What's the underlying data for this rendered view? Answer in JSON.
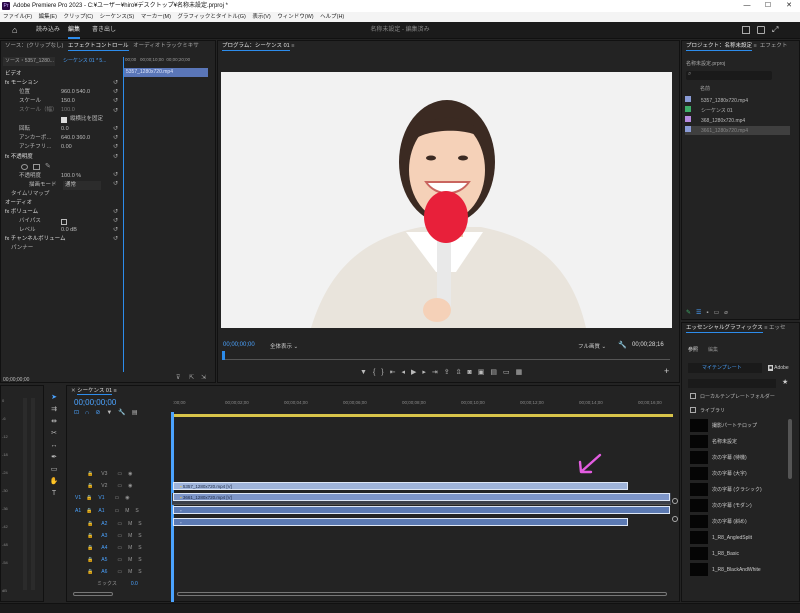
{
  "window": {
    "title": "Adobe Premiere Pro 2023 - C:¥ユーザー¥hiro¥デスクトップ¥名称未設定.prproj *",
    "app_badge": "Pr",
    "minimize": "—",
    "maximize": "☐",
    "close": "✕"
  },
  "menu": [
    "ファイル(F)",
    "編集(E)",
    "クリップ(C)",
    "シーケンス(S)",
    "マーカー(M)",
    "グラフィックとタイトル(G)",
    "表示(V)",
    "ウィンドウ(W)",
    "ヘルプ(H)"
  ],
  "workspace": {
    "tabs": [
      "読み込み",
      "編集",
      "書き出し"
    ],
    "active": "編集",
    "center_title": "名称未設定 - 編集済み"
  },
  "effect_controls": {
    "tabs": [
      "ソース：(クリップなし)",
      "エフェクトコントロール",
      "オーディオトラックミキサ"
    ],
    "source_label": "ソース・5357_1280...",
    "sequence_label": "シーケンス 01 * 5...",
    "clip_name": "5357_1280x720.mp4",
    "timecodes": [
      "00;00",
      "00;00;10;00",
      "00;00;20;00"
    ],
    "video_section": "ビデオ",
    "audio_section": "オーディオ",
    "rows": [
      {
        "label": "fx  モーション",
        "value": ""
      },
      {
        "label": "位置",
        "value": "960.0   540.0"
      },
      {
        "label": "スケール",
        "value": "150.0"
      },
      {
        "label": "スケール（幅）",
        "value": "100.0"
      },
      {
        "label": "縦横比を固定",
        "value": ""
      },
      {
        "label": "回転",
        "value": "0.0"
      },
      {
        "label": "アンカーポ…",
        "value": "640.0   360.0"
      },
      {
        "label": "アンチフリ…",
        "value": "0.00"
      },
      {
        "label": "fx  不透明度",
        "value": ""
      },
      {
        "label": "不透明度",
        "value": "100.0 %"
      },
      {
        "label": "描画モード",
        "value": "通常"
      },
      {
        "label": "タイムリマップ",
        "value": ""
      },
      {
        "label": "fx  ボリューム",
        "value": ""
      },
      {
        "label": "バイパス",
        "value": ""
      },
      {
        "label": "レベル",
        "value": "0.0 dB"
      },
      {
        "label": "fx  チャンネルボリューム",
        "value": ""
      },
      {
        "label": "パンナー",
        "value": ""
      }
    ],
    "footer_timecode": "00;00;00;00"
  },
  "program_monitor": {
    "title": "プログラム：シーケンス 01",
    "timecode": "00;00;00;00",
    "fit": "全体表示",
    "quality": "フル画質",
    "duration": "00;00;28;16"
  },
  "project": {
    "tabs": [
      "プロジェクト：名称未設定",
      "エフェクト"
    ],
    "file_name": "名称未設定.prproj",
    "column": "名前",
    "items": [
      {
        "name": "5357_1280x720.mp4",
        "color": "#8a9bd6"
      },
      {
        "name": "シーケンス 01",
        "color": "#3fae6a"
      },
      {
        "name": "368_1280x720.mp4",
        "color": "#b58ae0"
      },
      {
        "name": "3661_1280x720.mp4",
        "color": "#8a9bd6"
      }
    ]
  },
  "essential_graphics": {
    "title": "エッセンシャルグラフィックス",
    "tab2": "エッセ",
    "subtabs": [
      "参照",
      "編集"
    ],
    "my_templates": "マイテンプレート",
    "adobe": "Adobe",
    "local_folder": "ローカルテンプレートフォルダー",
    "library": "ライブラリ",
    "templates": [
      "撮影パートテロップ",
      "名称未設定",
      "次の字幕 (待機)",
      "次の字幕 (大字)",
      "次の字幕 (クラシック)",
      "次の字幕 (モダン)",
      "次の字幕 (斜め)",
      "1_R8_AngledSplit",
      "1_R8_Basic",
      "1_R8_BlackAndWhite"
    ]
  },
  "timeline": {
    "tab": "シーケンス 01",
    "timecode": "00;00;00;00",
    "ruler": [
      ":00;00",
      "00;00;02;00",
      "00;00;04;00",
      "00;00;06;00",
      "00;00;08;00",
      "00;00;10;00",
      "00;00;12;00",
      "00;00;14;00",
      "00;00;16;00"
    ],
    "video_tracks": [
      "V3",
      "V2",
      "V1"
    ],
    "audio_tracks": [
      "A1",
      "A2",
      "A3",
      "A4",
      "A5",
      "A6"
    ],
    "mix": "ミックス",
    "mix_value": "0.0",
    "clips": [
      {
        "track": "V2",
        "label": "5357_1280x720.mp4 [V]",
        "color": "#9fb4da"
      },
      {
        "track": "V1",
        "label": "3661_1280x720.mp4 [V]",
        "color": "#7d95c8"
      },
      {
        "track": "A1",
        "label": "",
        "color": "#5c7ab3"
      },
      {
        "track": "A2",
        "label": "",
        "color": "#5c7ab3"
      }
    ]
  },
  "meter": {
    "labels": [
      "0",
      "-6",
      "-12",
      "-18",
      "-24",
      "-30",
      "-36",
      "-42",
      "-48",
      "-54",
      "dB"
    ]
  },
  "annotation": {
    "arrow_color": "#e35ce0"
  },
  "colors": {
    "accent": "#2d8ceb",
    "playhead": "#4ba3ff"
  }
}
